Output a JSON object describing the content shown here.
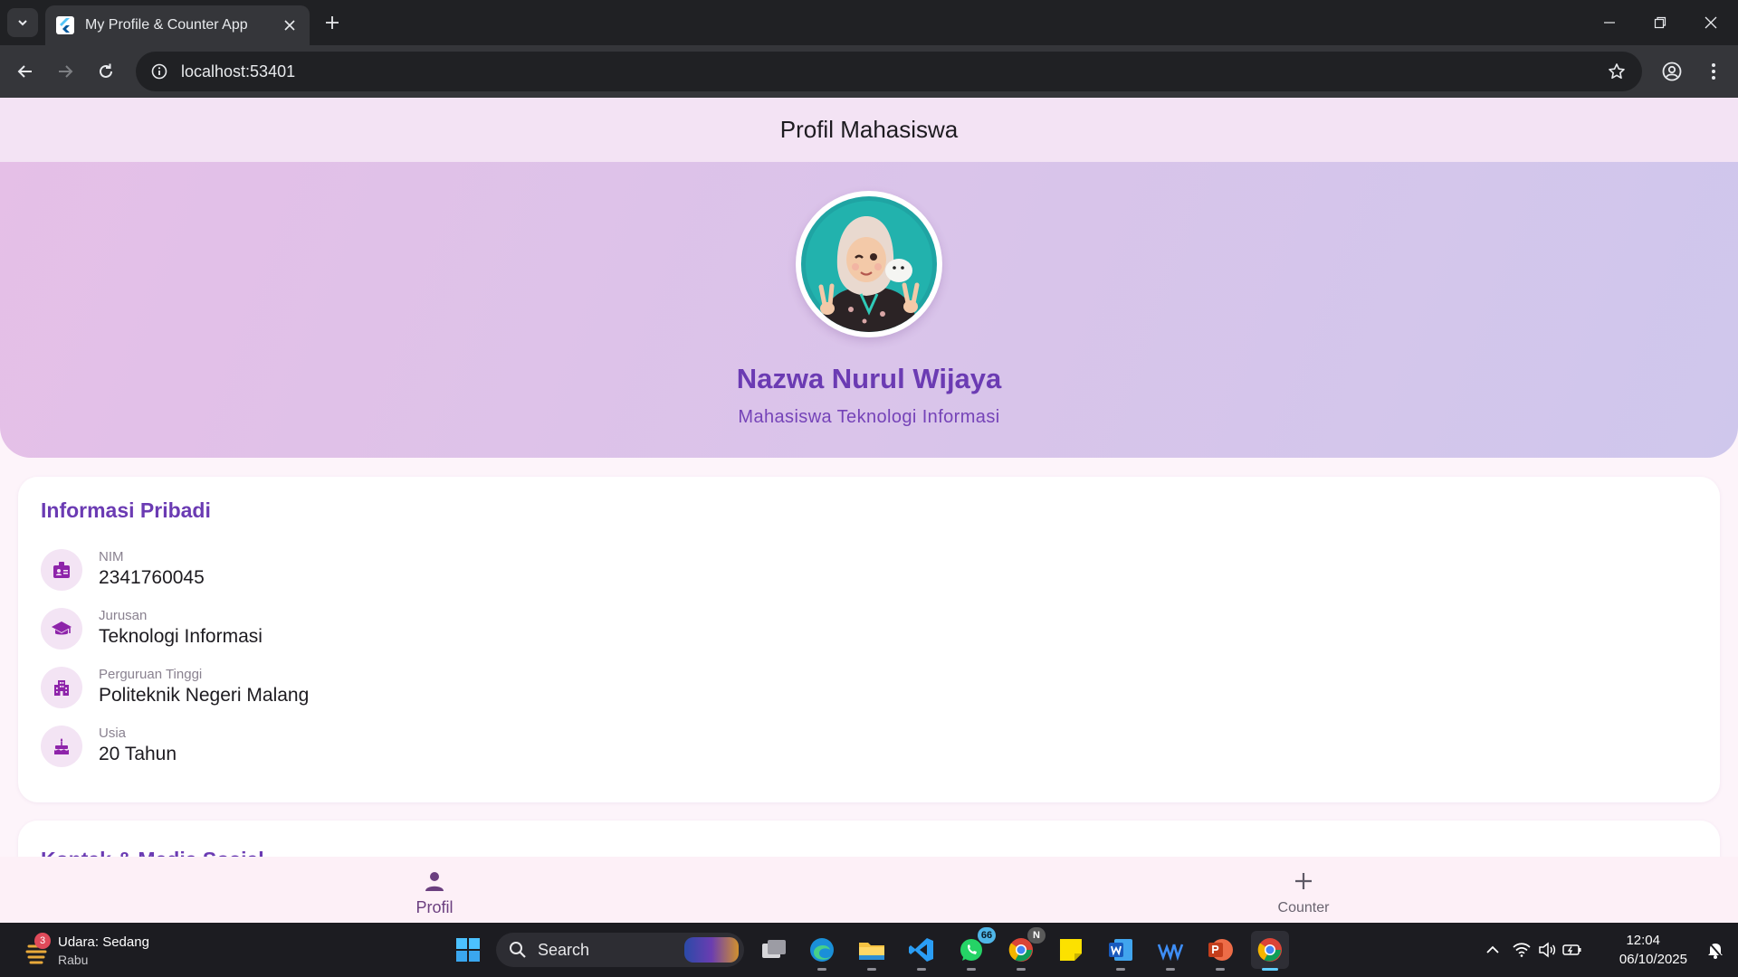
{
  "browser": {
    "tab_title": "My Profile & Counter App",
    "url": "localhost:53401"
  },
  "app": {
    "appbar_title": "Profil Mahasiswa",
    "profile": {
      "name": "Nazwa Nurul Wijaya",
      "role": "Mahasiswa Teknologi Informasi"
    },
    "info_card": {
      "title": "Informasi Pribadi",
      "rows": [
        {
          "label": "NIM",
          "value": "2341760045",
          "icon": "badge-icon"
        },
        {
          "label": "Jurusan",
          "value": "Teknologi Informasi",
          "icon": "school-icon"
        },
        {
          "label": "Perguruan Tinggi",
          "value": "Politeknik Negeri Malang",
          "icon": "building-icon"
        },
        {
          "label": "Usia",
          "value": "20 Tahun",
          "icon": "cake-icon"
        }
      ]
    },
    "contact_card": {
      "title": "Kontak & Media Sosial"
    },
    "bottom_nav": [
      {
        "label": "Profil",
        "icon": "person-icon",
        "selected": true
      },
      {
        "label": "Counter",
        "icon": "plus-icon",
        "selected": false
      }
    ],
    "colors": {
      "accent": "#6b3bb3",
      "appbar_bg": "#f3e3f4",
      "icon_bg": "#f3e4f4",
      "page_bg": "#fdf4fa"
    }
  },
  "taskbar": {
    "weather": {
      "title": "Udara: Sedang",
      "subtitle": "Rabu",
      "badge": "3"
    },
    "search_label": "Search",
    "apps": [
      {
        "name": "windows-start",
        "badge": ""
      },
      {
        "name": "task-view",
        "badge": ""
      },
      {
        "name": "edge",
        "badge": ""
      },
      {
        "name": "file-explorer",
        "badge": ""
      },
      {
        "name": "vscode",
        "badge": ""
      },
      {
        "name": "whatsapp",
        "badge": "66"
      },
      {
        "name": "chrome-profile",
        "badge": "N"
      },
      {
        "name": "sticky-notes",
        "badge": ""
      },
      {
        "name": "word",
        "badge": ""
      },
      {
        "name": "wavesaudio",
        "badge": ""
      },
      {
        "name": "powerpoint",
        "badge": ""
      },
      {
        "name": "chrome",
        "badge": ""
      }
    ],
    "clock": {
      "time": "12:04",
      "date": "06/10/2025"
    }
  }
}
